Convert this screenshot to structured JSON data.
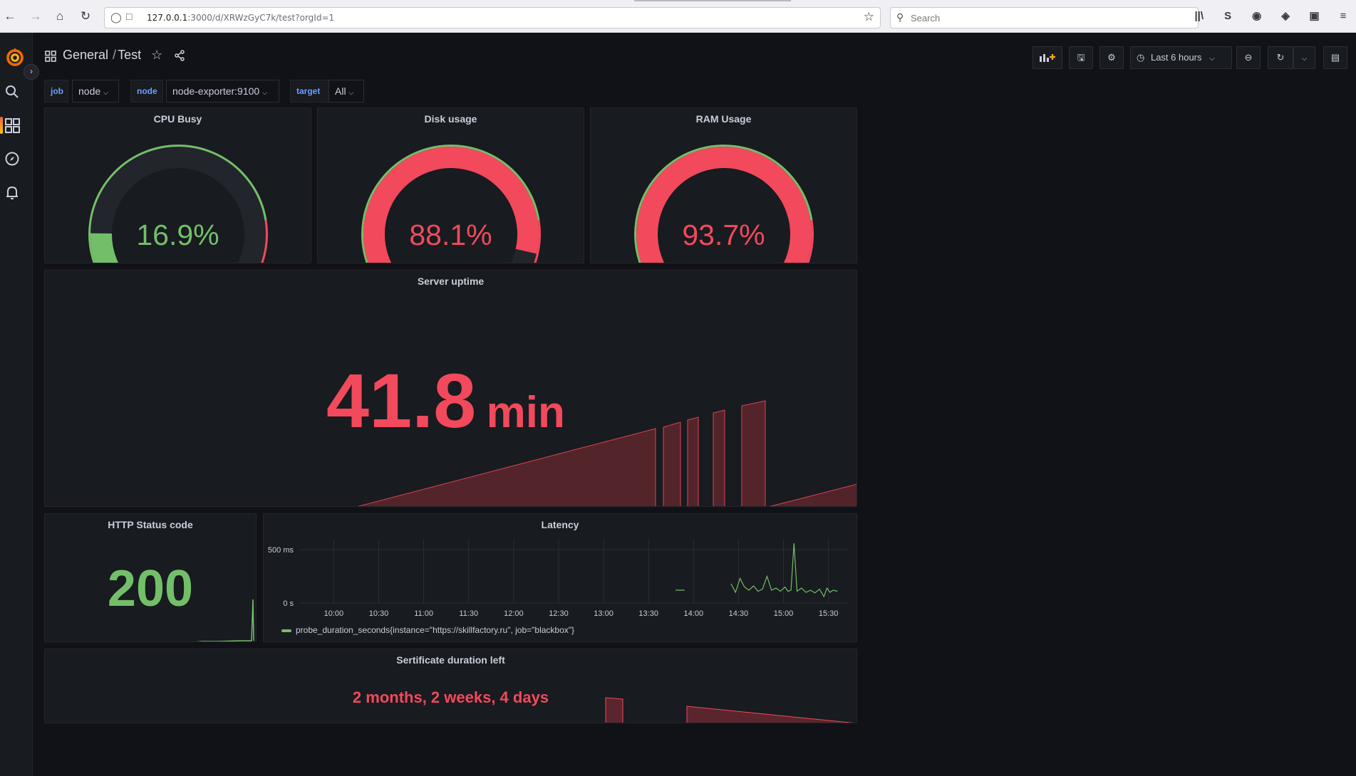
{
  "browser": {
    "url_host": "127.0.0.1",
    "url_path": ":3000/d/XRWzGyC7k/test?orgId=1",
    "search_placeholder": "Search"
  },
  "nav": {
    "folder": "General",
    "dashboard": "Test",
    "separator": "/",
    "time_range": "Last 6 hours"
  },
  "variables": [
    {
      "label": "job",
      "value": "node"
    },
    {
      "label": "node",
      "value": "node-exporter:9100"
    },
    {
      "label": "target",
      "value": "All"
    }
  ],
  "panels": {
    "cpu": {
      "title": "CPU Busy",
      "value": "16.9%",
      "fraction": 0.169
    },
    "disk": {
      "title": "Disk usage",
      "value": "88.1%",
      "fraction": 0.881
    },
    "ram": {
      "title": "RAM Usage",
      "value": "93.7%",
      "fraction": 0.937
    },
    "uptime": {
      "title": "Server uptime",
      "value": "41.8",
      "unit": "min"
    },
    "http": {
      "title": "HTTP Status code",
      "value": "200"
    },
    "latency": {
      "title": "Latency",
      "legend": "probe_duration_seconds{instance=\"https://skillfactory.ru\", job=\"blackbox\"}"
    },
    "cert": {
      "title": "Sertificate duration left",
      "value": "2 months, 2 weeks, 4 days"
    }
  },
  "colors": {
    "green": "#73bf69",
    "red": "#f2495c",
    "background": "#111217",
    "panel": "#181b1f"
  },
  "chart_data": {
    "type": "line",
    "title": "Latency",
    "x_ticks": [
      "10:00",
      "10:30",
      "11:00",
      "11:30",
      "12:00",
      "12:30",
      "13:00",
      "13:30",
      "14:00",
      "14:30",
      "15:00",
      "15:30"
    ],
    "y_ticks": [
      "0 s",
      "500 ms"
    ],
    "ylim": [
      0,
      600
    ],
    "series": [
      {
        "name": "probe_duration_seconds{instance=\"https://skillfactory.ru\", job=\"blackbox\"}",
        "color": "#73bf69",
        "points": [
          [
            "13:48",
            120
          ],
          [
            "13:54",
            120
          ],
          [
            "14:25",
            180
          ],
          [
            "14:28",
            100
          ],
          [
            "14:31",
            230
          ],
          [
            "14:34",
            150
          ],
          [
            "14:37",
            120
          ],
          [
            "14:40",
            160
          ],
          [
            "14:43",
            110
          ],
          [
            "14:46",
            130
          ],
          [
            "14:49",
            250
          ],
          [
            "14:52",
            120
          ],
          [
            "14:55",
            140
          ],
          [
            "14:58",
            110
          ],
          [
            "15:01",
            150
          ],
          [
            "15:03",
            110
          ],
          [
            "15:05",
            120
          ],
          [
            "15:07",
            560
          ],
          [
            "15:09",
            110
          ],
          [
            "15:12",
            140
          ],
          [
            "15:15",
            100
          ],
          [
            "15:18",
            120
          ],
          [
            "15:21",
            95
          ],
          [
            "15:24",
            130
          ],
          [
            "15:27",
            60
          ],
          [
            "15:29",
            140
          ],
          [
            "15:31",
            100
          ],
          [
            "15:33",
            120
          ],
          [
            "15:36",
            110
          ]
        ]
      }
    ]
  }
}
